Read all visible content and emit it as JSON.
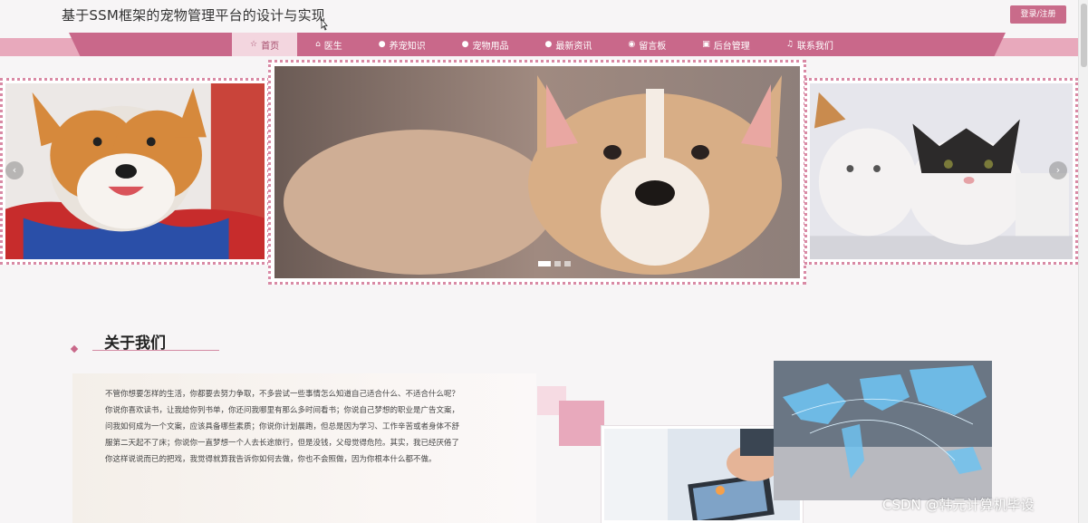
{
  "header": {
    "site_title": "基于SSM框架的宠物管理平台的设计与实现",
    "login_label": "登录/注册"
  },
  "nav": {
    "items": [
      {
        "icon": "star-icon",
        "glyph": "☆",
        "label": "首页",
        "active": true
      },
      {
        "icon": "home-icon",
        "glyph": "⌂",
        "label": "医生"
      },
      {
        "icon": "info-circle-icon",
        "glyph": "●",
        "label": "养宠知识"
      },
      {
        "icon": "question-circle-icon",
        "glyph": "●",
        "label": "宠物用品"
      },
      {
        "icon": "info-circle-icon",
        "glyph": "●",
        "label": "最新资讯"
      },
      {
        "icon": "globe-icon",
        "glyph": "◉",
        "label": "留言板"
      },
      {
        "icon": "dashboard-icon",
        "glyph": "▣",
        "label": "后台管理"
      },
      {
        "icon": "headset-icon",
        "glyph": "♫",
        "label": "联系我们"
      }
    ]
  },
  "carousel": {
    "prev_glyph": "‹",
    "next_glyph": "›",
    "active_index": 0,
    "slide_count": 3
  },
  "about": {
    "title": "关于我们",
    "body": "不管你想要怎样的生活，你都要去努力争取，不多尝试一些事情怎么知道自己适合什么、不适合什么呢？你说你喜欢读书，让我给你列书单，你还问我哪里有那么多时间看书；你说自己梦想的职业是广告文案，问我如何成为一个文案，应该具备哪些素质；你说你计划晨跑，但总是因为学习、工作辛苦或者身体不舒服第二天起不了床；你说你一直梦想一个人去长途旅行，但是没钱，父母觉得危险。其实，我已经厌倦了你这样说说而已的把戏，我觉得就算我告诉你如何去做，你也不会照做，因为你根本什么都不做。"
  },
  "watermark": "CSDN @韩元计算机毕设",
  "colors": {
    "accent": "#c9688a",
    "accent_light": "#e8a9bc",
    "active_tab_bg": "#f3d6df"
  }
}
